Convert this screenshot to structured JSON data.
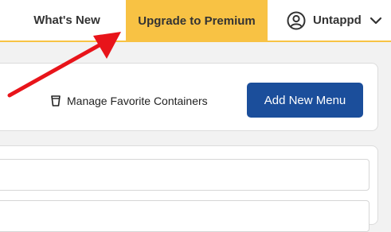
{
  "nav": {
    "whats_new": "What's New",
    "upgrade": "Upgrade to Premium",
    "account_label": "Untappd",
    "account_icon": "user-circle-icon",
    "dropdown_icon": "chevron-down-icon"
  },
  "toolbar": {
    "manage_containers": "Manage Favorite Containers",
    "manage_icon": "cup-icon",
    "add_menu": "Add New Menu"
  },
  "colors": {
    "premium": "#f8c244",
    "primary_button": "#1b4e9b",
    "annotation_arrow": "#e8141a"
  }
}
